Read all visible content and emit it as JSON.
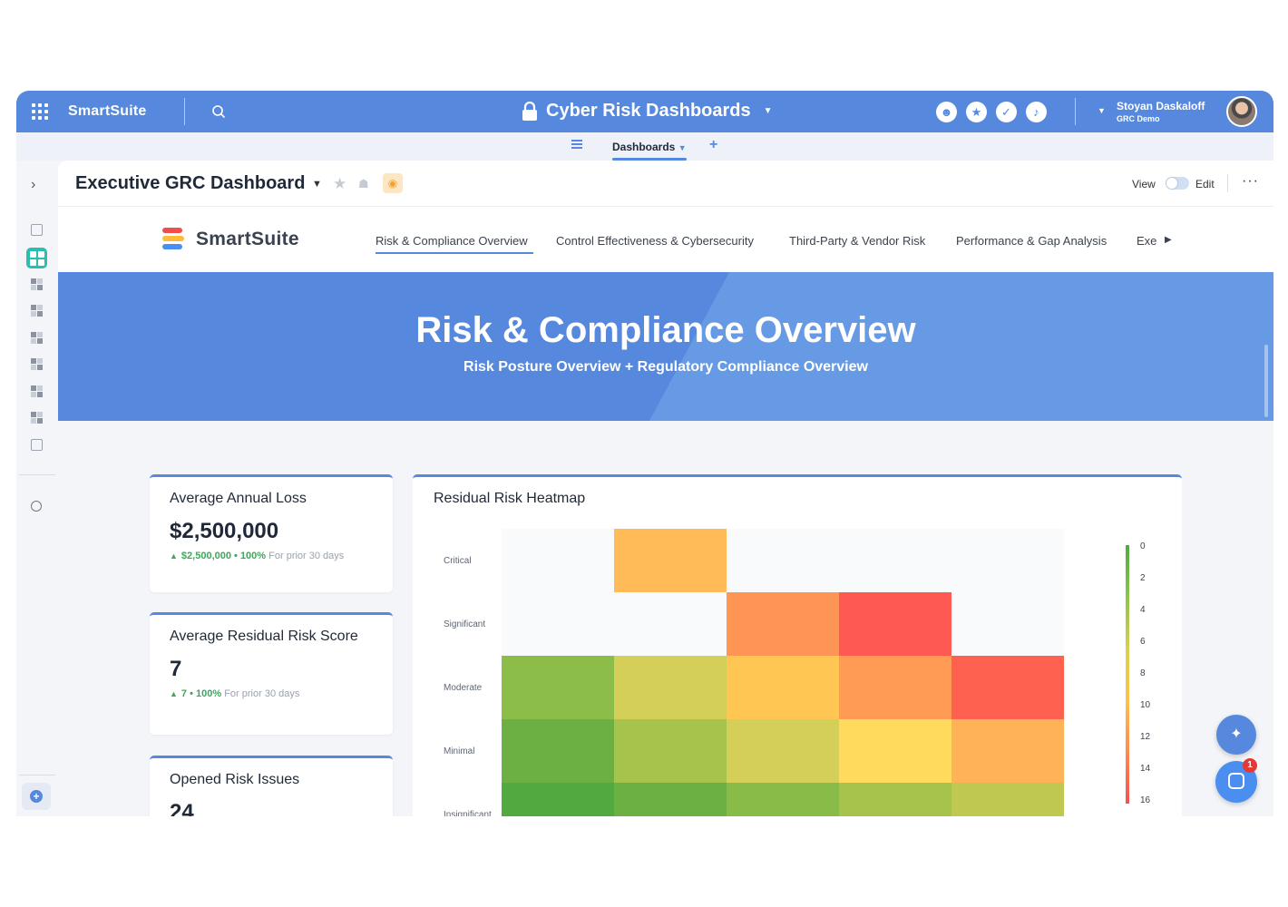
{
  "topbar": {
    "brand": "SmartSuite",
    "workspace_title": "Cyber Risk Dashboards",
    "user_name": "Stoyan Daskaloff",
    "user_org": "GRC Demo",
    "color": "#5688dd"
  },
  "tabs": {
    "active_label": "Dashboards"
  },
  "panel": {
    "title": "Executive GRC Dashboard",
    "view_label": "View",
    "edit_label": "Edit"
  },
  "inner_nav": {
    "logo_text": "SmartSuite",
    "items": [
      "Risk & Compliance Overview",
      "Control Effectiveness & Cybersecurity",
      "Third-Party & Vendor Risk",
      "Performance & Gap Analysis",
      "Exe"
    ]
  },
  "hero": {
    "title": "Risk & Compliance Overview",
    "subtitle": "Risk Posture Overview + Regulatory Compliance Overview"
  },
  "cards": [
    {
      "title": "Average Annual Loss",
      "value": "$2,500,000",
      "delta": "$2,500,000 • 100%",
      "delta_note": "For prior 30 days"
    },
    {
      "title": "Average Residual Risk Score",
      "value": "7",
      "delta": "7 • 100%",
      "delta_note": "For prior 30 days"
    },
    {
      "title": "Opened Risk Issues",
      "value": "24"
    }
  ],
  "heatmap": {
    "title": "Residual Risk Heatmap",
    "rows": [
      "Critical",
      "Significant",
      "Moderate",
      "Minimal",
      "Insignificant"
    ],
    "legend": [
      "0",
      "2",
      "4",
      "6",
      "8",
      "10",
      "12",
      "14",
      "16"
    ],
    "cells": [
      [
        null,
        "#ffbb57",
        null,
        null,
        null
      ],
      [
        null,
        null,
        "#ff9555",
        "#ff5a52",
        null
      ],
      [
        "#8bbd48",
        "#d4cf58",
        "#ffc653",
        "#ff9b55",
        "#ff6150"
      ],
      [
        "#6cb044",
        "#a6c34b",
        "#d4cf58",
        "#ffda5c",
        "#ffb356"
      ],
      [
        "#52a940",
        "#6cb044",
        "#88bb47",
        "#a6c34b",
        "#bfc952"
      ]
    ]
  },
  "fab": {
    "badge": "1"
  }
}
